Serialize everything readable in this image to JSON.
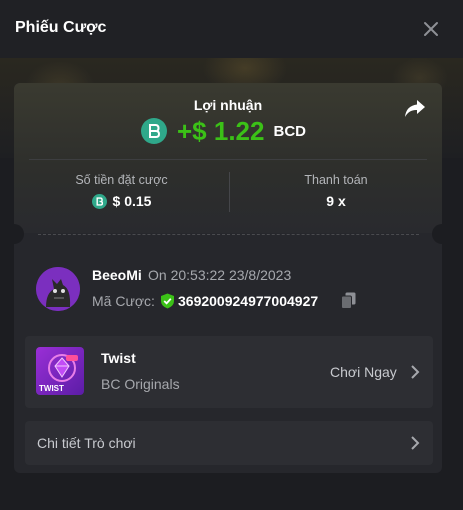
{
  "header": {
    "title": "Phiếu Cược"
  },
  "profit": {
    "label": "Lợi nhuận",
    "amount": "+$ 1.22",
    "currency": "BCD"
  },
  "stats": {
    "bet_amount_label": "Số tiền đặt cược",
    "bet_amount_value": "$ 0.15",
    "payout_label": "Thanh toán",
    "payout_value": "9 x"
  },
  "user": {
    "name": "BeeoMi",
    "on_time": "On 20:53:22 23/8/2023",
    "bet_id_label": "Mã Cược:",
    "bet_id": "369200924977004927"
  },
  "game": {
    "name": "Twist",
    "provider": "BC Originals",
    "play_label": "Chơi Ngay",
    "thumb_text": "TWIST"
  },
  "details": {
    "label": "Chi tiết Trò chơi"
  },
  "colors": {
    "profit_green": "#3bc117",
    "coin_teal": "#2fa88a",
    "avatar_purple": "#7b2fbf",
    "verified_green": "#3bc117"
  },
  "icons": [
    "close-icon",
    "share-icon",
    "bcd-coin-icon",
    "verified-shield-icon",
    "copy-icon",
    "chevron-right-icon"
  ]
}
